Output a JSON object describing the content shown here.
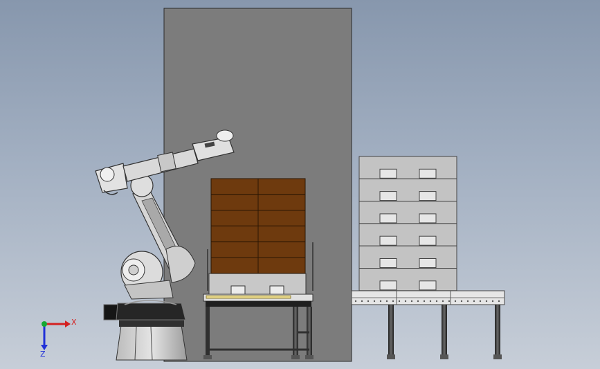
{
  "viewport": {
    "background_top": "#8797ad",
    "background_bottom": "#c7ced8"
  },
  "scene": {
    "wall_color": "#7c7c7c",
    "carton_color": "#6e3a0e",
    "pallet_stack_color": "#c3c3c3",
    "robot_color": "#d6d6d6",
    "frame_color": "#2f2f2f",
    "conveyor_color": "#e6e6e6",
    "carton_stack": {
      "columns": 2,
      "rows": 6
    },
    "empty_pallet_stack": {
      "count": 6
    }
  },
  "triad": {
    "x_label": "X",
    "z_label": "Z",
    "x_color": "#d42020",
    "y_color": "#16a832",
    "z_color": "#2030d8"
  }
}
